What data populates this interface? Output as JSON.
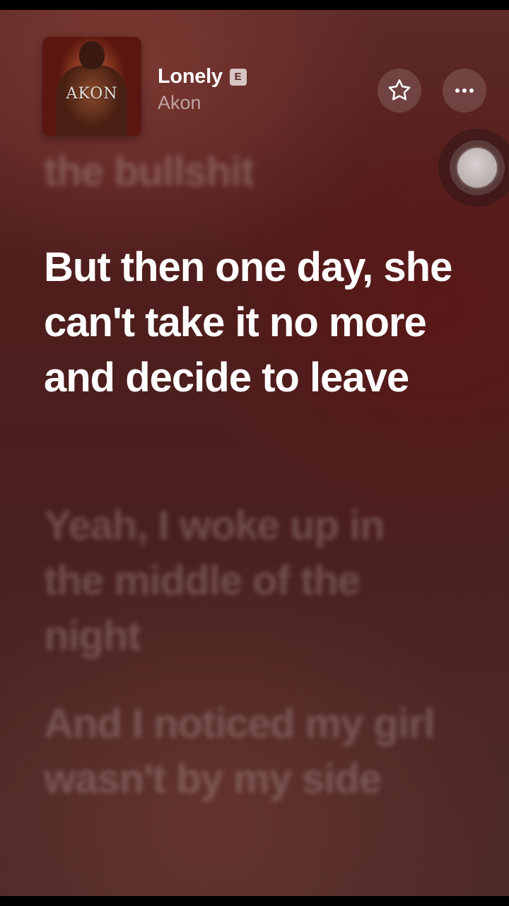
{
  "now_playing": {
    "title": "Lonely",
    "explicit_label": "E",
    "artist": "Akon",
    "album_art_text": "AKON"
  },
  "icons": {
    "favorite": "star-outline-icon",
    "more": "ellipsis-icon",
    "assistive_touch": "assistive-touch-icon"
  },
  "lyrics": {
    "previous": "the bullshit",
    "current": "But then one day, she can't take it no more and decide to leave",
    "upcoming": [
      "Yeah, I woke up in the middle of the night",
      "And I noticed my girl wasn't by my side"
    ]
  },
  "colors": {
    "background": "#4e1d1c",
    "lyric_active": "#ffffff",
    "lyric_inactive": "rgba(255,255,255,0.2)"
  }
}
